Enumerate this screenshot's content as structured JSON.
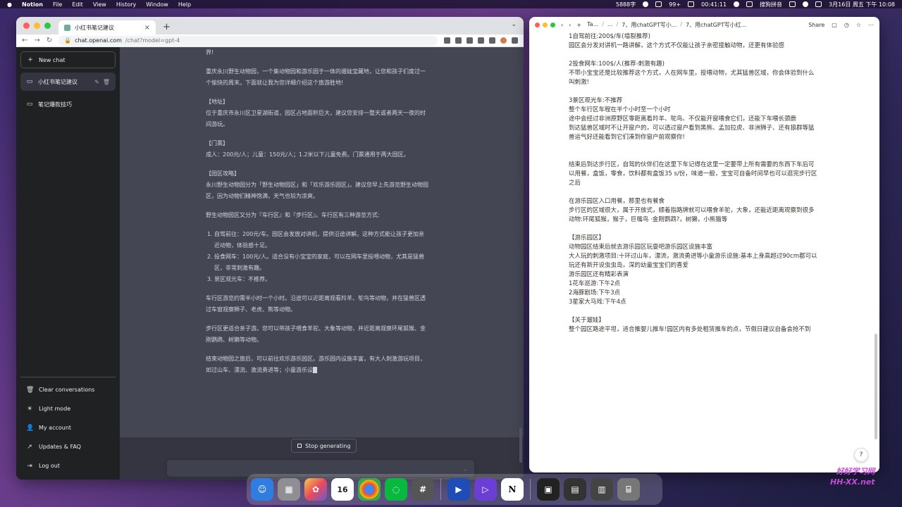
{
  "menubar": {
    "app_name": "Notion",
    "items": [
      "File",
      "Edit",
      "View",
      "History",
      "Window",
      "Help"
    ],
    "word_count": "5888字",
    "badge": "99+",
    "timer": "00:41:11",
    "input_method": "搜狗拼音",
    "datetime": "3月16日 周五 下午 10:08"
  },
  "chrome": {
    "tab_title": "小红书笔记建议",
    "url_host": "chat.openai.com",
    "url_path": "/chat?model=gpt-4"
  },
  "sidebar": {
    "new_chat": "New chat",
    "conversations": [
      "小红书笔记建议",
      "笔记爆款技巧"
    ],
    "bottom": [
      "Clear conversations",
      "Light mode",
      "My account",
      "Updates & FAQ",
      "Log out"
    ]
  },
  "chat": {
    "p0": "界!",
    "p1": "重庆永川野生动物园，一个集动物园和游乐园于一体的遛娃宝藏地，让您和孩子们度过一个愉快的周末。下面就让我为您详细介绍这个旅游胜地!",
    "h_addr": "【地址】",
    "p_addr": "位于重庆市永川区卫星湖街道，园区占地面积巨大，建议您安排一整天或者两天一夜的时间游玩。",
    "h_ticket": "【门票】",
    "p_ticket": "成人：200元/人；儿童：150元/人；1.2米以下儿童免费。门票通用于两大园区。",
    "h_guide": "【园区攻略】",
    "p_guide": "永川野生动物园分为「野生动物园区」和「欢乐游乐园区」。建议您早上先游览野生动物园区，因为动物们精神饱满，天气也较为凉爽。",
    "p_modes": "野生动物园区又分为『车行区』和『步行区』。车行区有三种游览方式:",
    "list": [
      "自驾前往：200元/车。园区会发放对讲机，提供沿途讲解。这种方式能让孩子更加亲近动物，体验感十足。",
      "投食网车：100元/人。适合没有小宝宝的家庭，可以在网车里投喂动物，尤其是猛兽区，非常刺激有趣。",
      "景区观光车：不推荐。"
    ],
    "p_drive": "车行区游览约需半小时一个小时。沿途可以近距离观看羚羊、鸵鸟等动物，并在猛兽区透过车窗观察狮子、老虎、熊等动物。",
    "p_walk": "步行区更适合亲子游。您可以带孩子喂食羊驼、大象等动物，并近距离观察环尾狐猴、金刚鹦鹉、树獭等动物。",
    "p_end": "结束动物园之旅后，可以前往欢乐游乐园区。游乐园内设施丰富，有大人刺激游玩项目，如过山车、漂流、激流勇进等；小童游乐设",
    "stop_generating": "Stop generating",
    "composer_icon": ".."
  },
  "notion": {
    "crumbs": [
      "Ta...",
      "...",
      "7、用chatGPT写小...",
      "7、用chatGPT写小红..."
    ],
    "share": "Share",
    "lines": [
      "1自驾前往:200$/车(墙裂推荐)",
      "园区会分发对讲机一路讲解，这个方式不仅能让孩子亲密接触动物，还更有体验感",
      "",
      "2投食网车:100$/人(推荐-刺激有趣)",
      "不带小宝宝还是比较推荐这个方式，人在网车里，投喂动物，尤其猛兽区域，你会体验到什么",
      "叫刺激!",
      "",
      "3景区观光车:不推荐",
      "整个车行区车程在半个小时至一个小时",
      "途中会经过非洲原野区零距离看羚羊、鸵鸟、不仅能开窗喂食它们，还能下车喂长颈鹿",
      "到达猛兽区域时不让开窗户的，可以透过窗户看到黑熊、孟加拉虎、非洲狮子、还有狼群等猛",
      "兽运气好还能看到它们凑到你窗户前观察你!",
      "",
      "",
      "结束后到达步行区，自驾的伙伴们在这里下车记得在这里一定要带上所有需要的东西下车后可",
      "以用餐，盒饭，零食，饮料都有盒饭35 s/份，味道一般，宝宝可自备时间早也可以逛完步行区",
      "之后",
      "",
      "在游乐园区入口用餐，那里也有餐食",
      "步行区的区域很大，属于开放式，顺着指路牌就可以喂食羊驼，大象，还能近距离观察到很多",
      "动物:环尾狐猴，猴子，巨嘴鸟 ·金刚鹦鹉?，树獭，小熊猫等",
      "",
      "【游乐园区】",
      "动物园区结束后就去游乐园区玩耍吧游乐园区设施丰富",
      "大人玩的刺激项目:十环过山车，漂流，激流勇进等小童游乐设施:基本上身高超过90cm都可以",
      "玩还有新开设虫虫岛，深的幼童宝宝们的喜爱",
      "游乐园区还有精彩表演",
      "1花车巡游:下午2点",
      "2海豚剧场:下午3点",
      "3星家大马戏:下午4点",
      "",
      "【关于遛娃】",
      "整个园区路途平坦，适合推婴儿推车!园区内有多处租赁推车的点，节假日建议自备会抢不到"
    ],
    "help": "?"
  },
  "dock": {
    "calendar_day": "16",
    "apps": [
      "finder-icon",
      "launchpad-icon",
      "photos-icon",
      "calendar-icon",
      "chrome-icon",
      "wechat-icon",
      "calculator-icon",
      "app-icon",
      "app-icon",
      "notion-icon",
      "trash-icon"
    ]
  },
  "watermark": {
    "line1": "好好学习网",
    "line2": "HH-XX.net"
  },
  "colors": {
    "chat_bg": "#343541",
    "chat_msg_bg": "#444654",
    "sidebar_bg": "#202123",
    "notion_text": "#37352f"
  }
}
